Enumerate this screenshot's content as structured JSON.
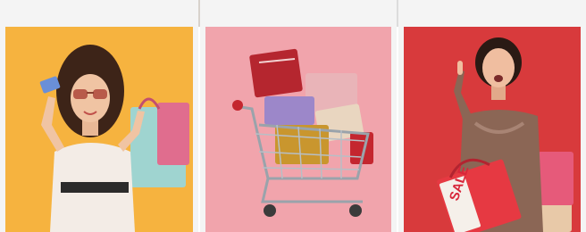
{
  "gallery": {
    "cards": [
      {
        "id": "card-1",
        "background": "#f6b33f",
        "subject": "woman-with-card-and-bags"
      },
      {
        "id": "card-2",
        "background": "#f1a4ac",
        "subject": "cart-with-gift-boxes"
      },
      {
        "id": "card-3",
        "background": "#d83a3c",
        "subject": "surprised-woman-with-sale-bags",
        "bag_text": "SALE"
      }
    ]
  },
  "colors": {
    "page_bg": "#ffffff",
    "strip": "#dcdcdc",
    "card_bg": "#f4f4f4"
  }
}
